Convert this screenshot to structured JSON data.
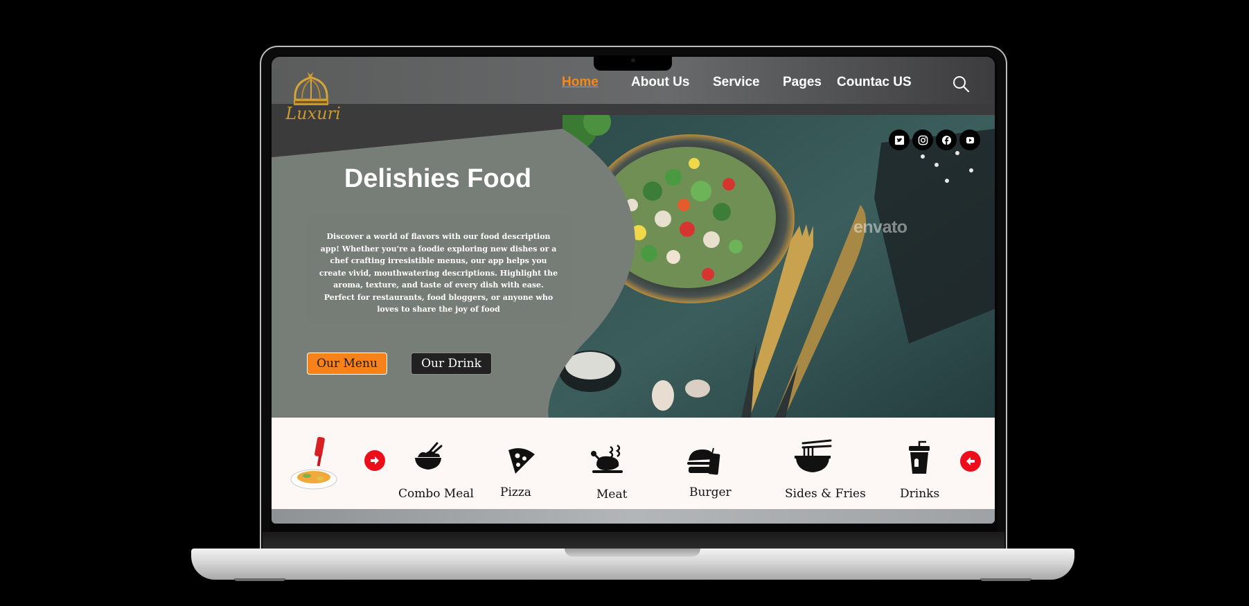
{
  "brand": {
    "logo_text": "Luxuri"
  },
  "nav": {
    "items": [
      {
        "label": "Home",
        "active": true
      },
      {
        "label": "About Us",
        "active": false
      },
      {
        "label": "Service",
        "active": false
      },
      {
        "label": "Pages",
        "active": false
      },
      {
        "label": "Countac US",
        "active": false
      }
    ],
    "search_icon": "search-icon"
  },
  "hero": {
    "title": "Delishies Food",
    "description": "Discover a world of flavors with our food description app! Whether you're a foodie exploring new dishes or a chef crafting irresistible menus, our app helps you create vivid, mouthwatering descriptions. Highlight the aroma, texture, and taste of every dish with ease. Perfect for restaurants, food bloggers, or anyone who loves to share the joy of food",
    "menu_button": "Our Menu",
    "drink_button": "Our Drink",
    "watermark": "envato"
  },
  "social": [
    "twitter-icon",
    "instagram-icon",
    "facebook-icon",
    "youtube-icon"
  ],
  "categories": {
    "prev_icon": "arrow-right-icon",
    "next_icon": "arrow-left-icon",
    "items": [
      {
        "label": "Combo Meal",
        "icon": "rice-bowl-icon"
      },
      {
        "label": "Pizza",
        "icon": "pizza-slice-icon"
      },
      {
        "label": "Meat",
        "icon": "roast-chicken-icon"
      },
      {
        "label": "Burger",
        "icon": "burger-icon"
      },
      {
        "label": "Sides & Fries",
        "icon": "noodle-bowl-icon"
      },
      {
        "label": "Drinks",
        "icon": "drink-cup-icon"
      }
    ]
  },
  "colors": {
    "accent": "#f7881a",
    "arrow": "#ee0d1a",
    "panel": "#767c76",
    "strip": "#fdf7f6"
  }
}
